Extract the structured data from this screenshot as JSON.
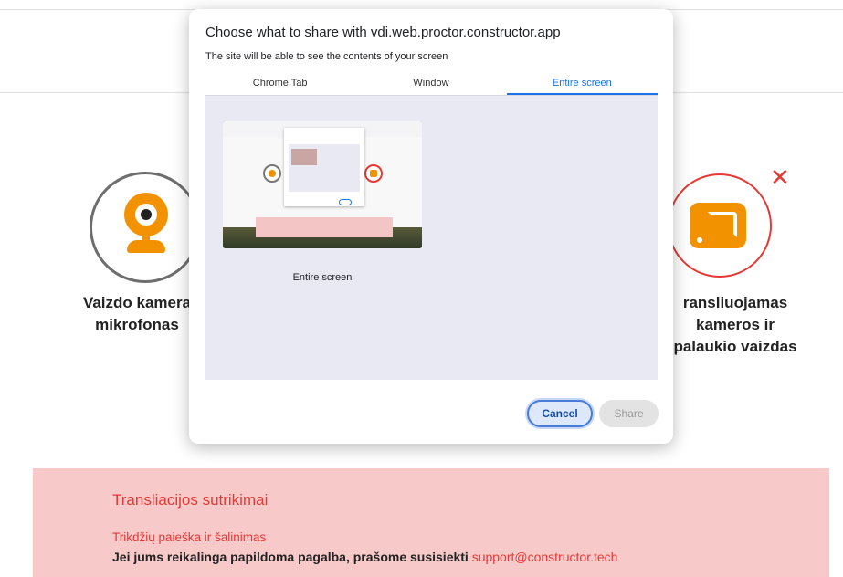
{
  "dialog": {
    "title": "Choose what to share with vdi.web.proctor.constructor.app",
    "subtitle": "The site will be able to see the contents of your screen",
    "tabs": [
      {
        "label": "Chrome Tab",
        "active": false
      },
      {
        "label": "Window",
        "active": false
      },
      {
        "label": "Entire screen",
        "active": true
      }
    ],
    "screen_item_label": "Entire screen",
    "cancel_label": "Cancel",
    "share_label": "Share"
  },
  "background": {
    "left_card": {
      "line1": "Vaizdo kamera",
      "line2": "mikrofonas",
      "icon": "webcam-icon"
    },
    "right_card": {
      "line1": "ransliuojamas",
      "line2": "kameros ir",
      "line3": "palaukio vaizdas",
      "icon": "screencast-icon",
      "status_icon": "close-icon",
      "status_mark": "✕"
    },
    "banner": {
      "title": "Transliacijos sutrikimai",
      "subtitle": "Trikdžių paieška ir šalinimas",
      "help_text": "Jei jums reikalinga papildoma pagalba, prašome susisiekti ",
      "support_email": "support@constructor.tech"
    }
  },
  "colors": {
    "accent_blue": "#1a73e8",
    "brand_orange": "#f39200",
    "error_red": "#e53935",
    "banner_bg": "#f8c9c9",
    "panel_bg": "#e8e9f3"
  }
}
